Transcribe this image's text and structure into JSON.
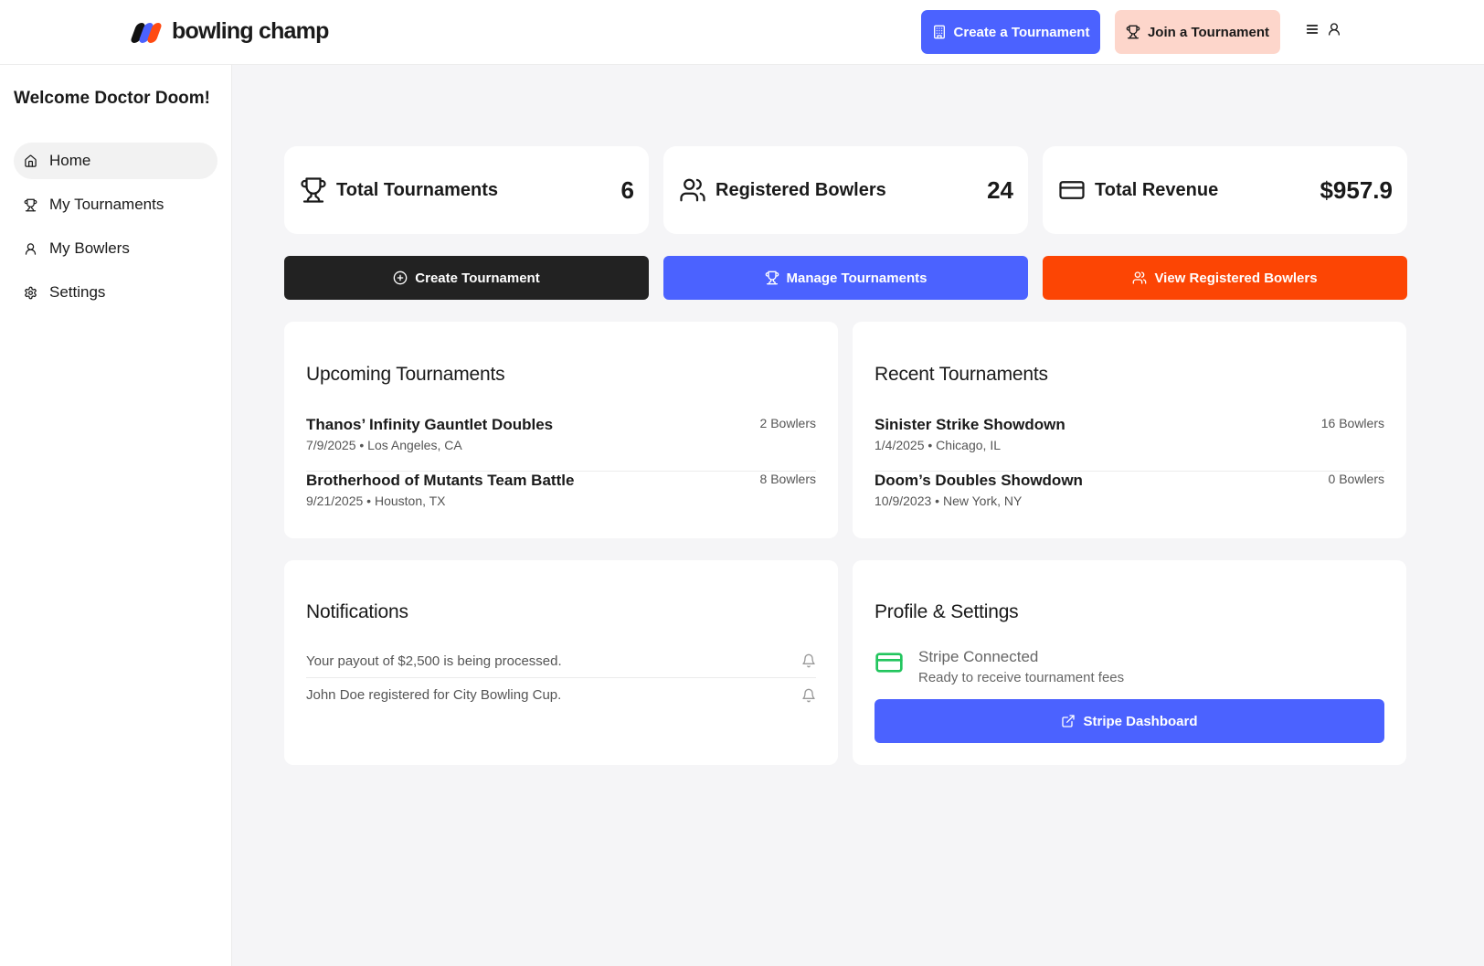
{
  "brand": {
    "name": "bowling champ",
    "logo_colors": [
      "#111111",
      "#4b62ff",
      "#ff4a12"
    ]
  },
  "header": {
    "create_label": "Create a Tournament",
    "join_label": "Join a Tournament",
    "icons": [
      "building-icon",
      "trophy-icon",
      "menu-icon",
      "user-icon"
    ]
  },
  "sidebar": {
    "welcome": "Welcome Doctor Doom!",
    "items": [
      {
        "label": "Home",
        "icon": "home-icon",
        "active": true
      },
      {
        "label": "My Tournaments",
        "icon": "trophy-icon",
        "active": false
      },
      {
        "label": "My Bowlers",
        "icon": "user-icon",
        "active": false
      },
      {
        "label": "Settings",
        "icon": "gear-icon",
        "active": false
      }
    ]
  },
  "stats": [
    {
      "label": "Total Tournaments",
      "value": "6",
      "icon": "trophy-icon"
    },
    {
      "label": "Registered Bowlers",
      "value": "24",
      "icon": "users-icon"
    },
    {
      "label": "Total Revenue",
      "value": "$957.9",
      "icon": "credit-card-icon"
    }
  ],
  "actions": [
    {
      "label": "Create Tournament",
      "icon": "plus-circle-icon",
      "color": "#222222"
    },
    {
      "label": "Manage Tournaments",
      "icon": "trophy-icon",
      "color": "#4b62ff"
    },
    {
      "label": "View Registered Bowlers",
      "icon": "users-icon",
      "color": "#fc4504"
    }
  ],
  "upcoming": {
    "title": "Upcoming Tournaments",
    "items": [
      {
        "name": "Thanos’ Infinity Gauntlet Doubles",
        "meta": "7/9/2025 • Los Angeles, CA",
        "count": "2 Bowlers"
      },
      {
        "name": "Brotherhood of Mutants Team Battle",
        "meta": "9/21/2025 • Houston, TX",
        "count": "8 Bowlers"
      }
    ]
  },
  "recent": {
    "title": "Recent Tournaments",
    "items": [
      {
        "name": "Sinister Strike Showdown",
        "meta": "1/4/2025 • Chicago, IL",
        "count": "16 Bowlers"
      },
      {
        "name": "Doom’s Doubles Showdown",
        "meta": "10/9/2023 • New York, NY",
        "count": "0 Bowlers"
      }
    ]
  },
  "notifications": {
    "title": "Notifications",
    "items": [
      {
        "text": "Your payout of $2,500 is being processed.",
        "icon": "bell-icon"
      },
      {
        "text": "John Doe registered for City Bowling Cup.",
        "icon": "bell-icon"
      }
    ]
  },
  "profile": {
    "title": "Profile & Settings",
    "stripe_status": "Stripe Connected",
    "stripe_sub": "Ready to receive tournament fees",
    "stripe_button": "Stripe Dashboard",
    "status_color": "#22c55e"
  }
}
